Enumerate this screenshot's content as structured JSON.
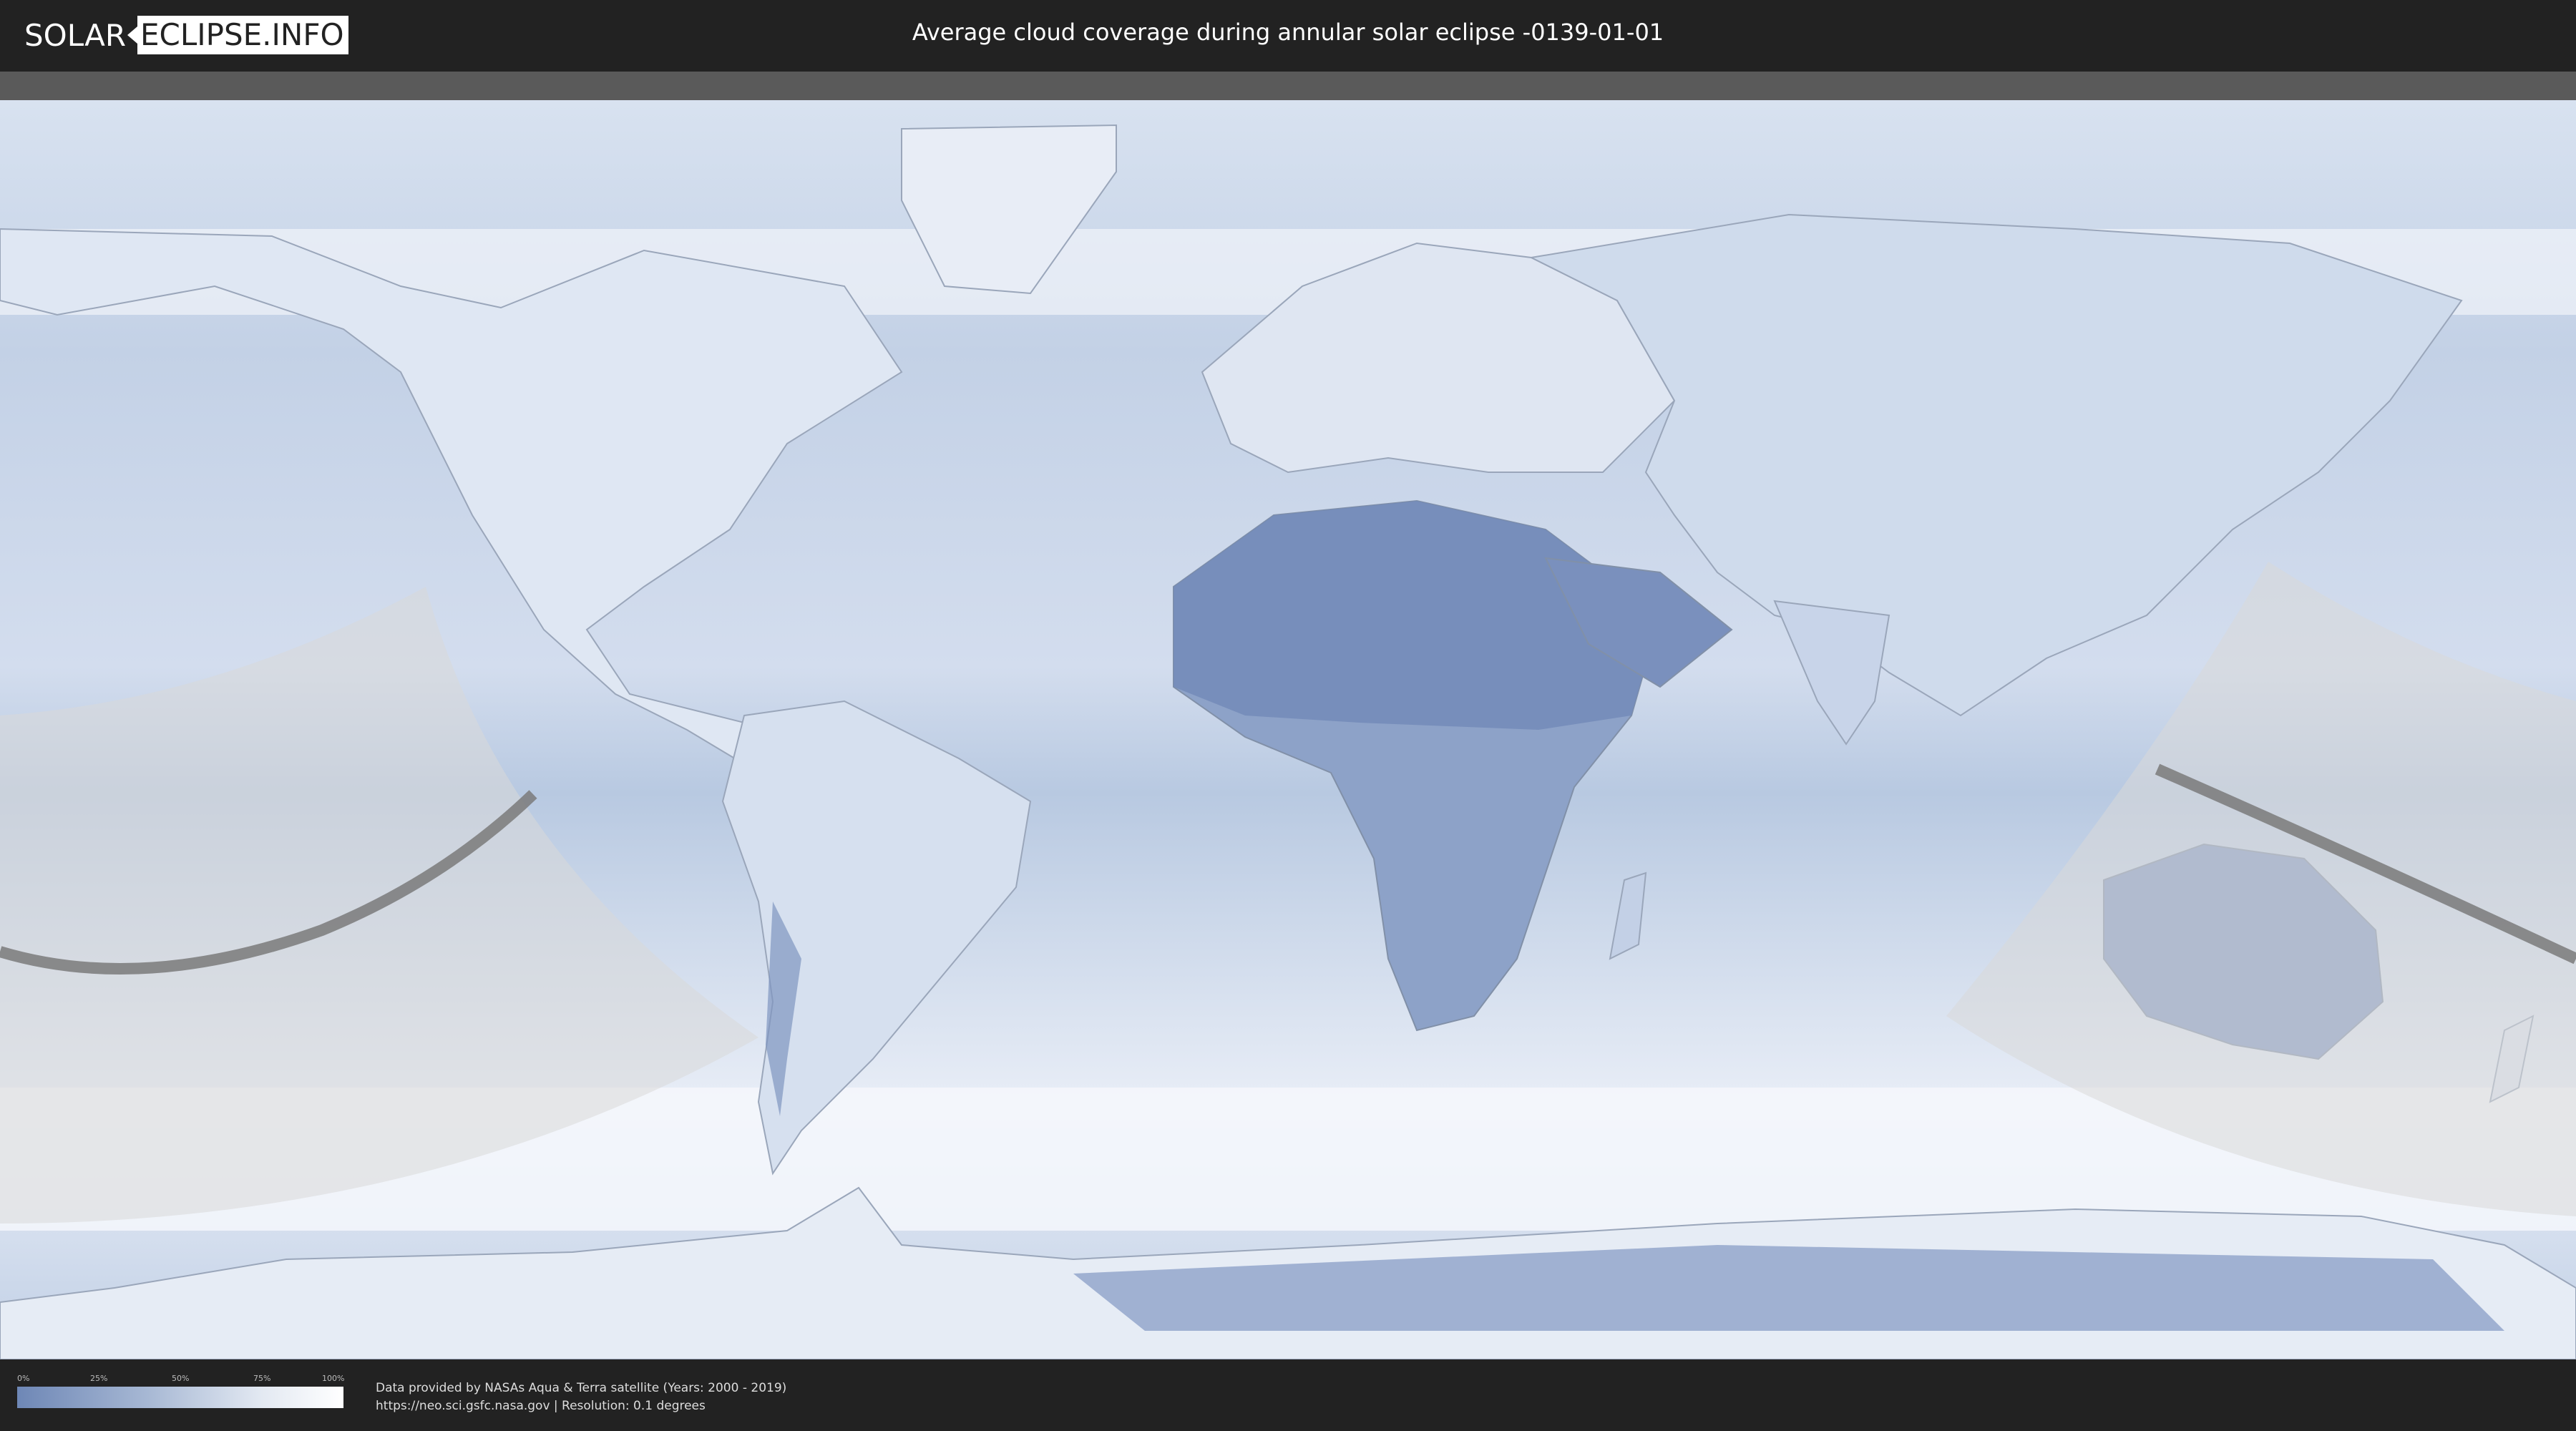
{
  "header": {
    "logo_solar": "SOLAR",
    "logo_eclipse": "ECLIPSE.INFO",
    "title": "Average cloud coverage during annular solar eclipse -0139-01-01"
  },
  "legend": {
    "ticks": [
      "0%",
      "25%",
      "50%",
      "75%",
      "100%"
    ],
    "gradient_colors": [
      "#6e87b6",
      "#a7b8d4",
      "#e3e9f2",
      "#ffffff"
    ]
  },
  "credits": {
    "line1": "Data provided by NASAs Aqua & Terra satellite (Years: 2000 - 2019)",
    "line2": "https://neo.sci.gsfc.nasa.gov | Resolution: 0.1 degrees"
  },
  "map": {
    "ocean_color": "#c9d6e9",
    "land_color": "#e6ecf5",
    "dry_color": "#7f95c0",
    "eclipse_shadow_color": "#d8d8d8",
    "path_color": "#7a7a7a"
  }
}
